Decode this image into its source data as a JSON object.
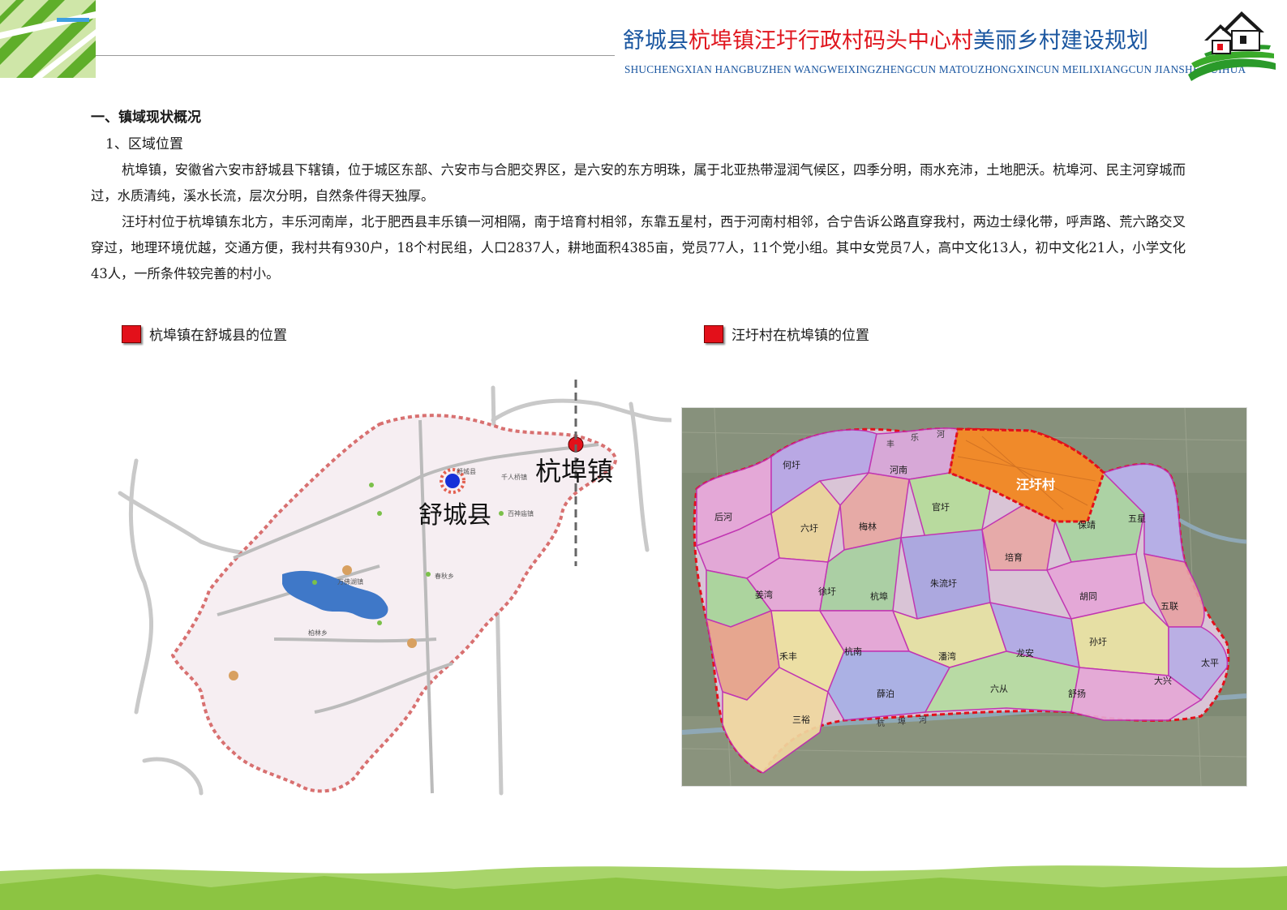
{
  "header": {
    "title_part1": "舒城县",
    "title_part2": "杭埠镇汪圩行政村码头中心村",
    "title_part3": "美丽乡村建设规划",
    "subtitle": "SHUCHENGXIAN HANGBUZHEN WANGWEIXINGZHENGCUN MATOUZHONGXINCUN MEILIXIANGCUN JIANSHE GUIHUA"
  },
  "content": {
    "section_heading": "一、镇域现状概况",
    "subsection_heading": "1、区域位置",
    "paragraph_1": "杭埠镇，安徽省六安市舒城县下辖镇，位于城区东部、六安市与合肥交界区，是六安的东方明珠，属于北亚热带湿润气候区，四季分明，雨水充沛，土地肥沃。杭埠河、民主河穿城而过，水质清纯，溪水长流，层次分明，自然条件得天独厚。",
    "paragraph_2": "汪圩村位于杭埠镇东北方，丰乐河南岸，北于肥西县丰乐镇一河相隔，南于培育村相邻，东靠五星村，西于河南村相邻，合宁告诉公路直穿我村，两边士绿化带，呼声路、荒六路交叉穿过，地理环境优越，交通方便，我村共有930户，18个村民组，人口2837人，耕地面积4385亩，党员77人，11个党小组。其中女党员7人，高中文化13人，初中文化21人，小学文化43人，一所条件较完善的村小。"
  },
  "legends": {
    "left_label": "杭埠镇在舒城县的位置",
    "right_label": "汪圩村在杭埠镇的位置",
    "swatch_color": "#e3101a"
  },
  "county_map": {
    "county_label": "舒城县",
    "town_label": "杭埠镇",
    "small_labels": [
      "舒城县",
      "千人桥镇",
      "百神庙镇",
      "万佛湖镇",
      "春秋乡",
      "柏林乡",
      "杭埠镇"
    ],
    "colors": {
      "county_marker": "#1630d8",
      "town_marker": "#e3101a",
      "boundary": "#d87070",
      "water": "#3f78c8"
    }
  },
  "township_map": {
    "highlight_village": "汪圩村",
    "villages": [
      "何圩",
      "河南",
      "后河",
      "六圩",
      "梅林",
      "官圩",
      "五星",
      "保靖",
      "培育",
      "姜湾",
      "徐圩",
      "杭埠",
      "朱流圩",
      "胡同",
      "五联",
      "禾丰",
      "杭南",
      "潘湾",
      "龙安",
      "孙圩",
      "太平",
      "三裕",
      "薛泊",
      "六从",
      "舒扬",
      "大兴"
    ],
    "river_labels": [
      "丰",
      "乐",
      "河",
      "杭",
      "埠",
      "河"
    ],
    "colors": {
      "highlight": "#f08a2a",
      "highlight_text": "#ffffff",
      "boundary": "#e3101a"
    }
  }
}
